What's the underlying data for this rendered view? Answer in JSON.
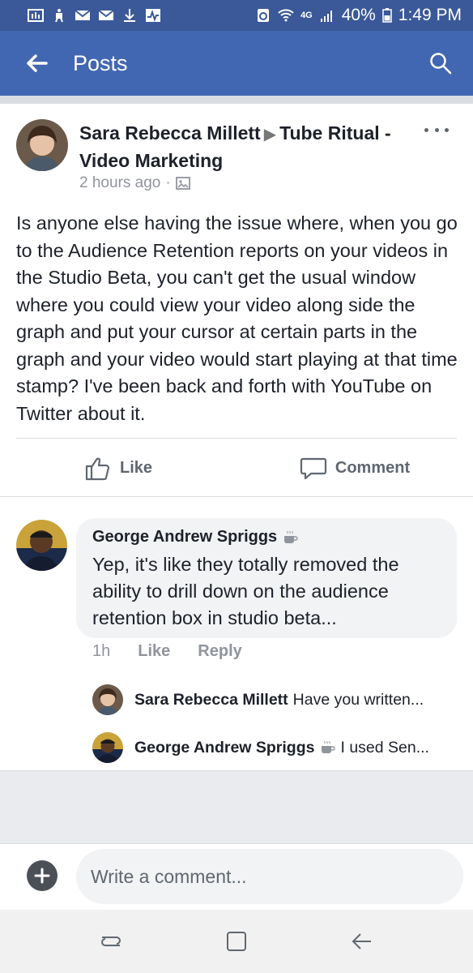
{
  "status_bar": {
    "battery": "40%",
    "time": "1:49 PM",
    "network": "4G"
  },
  "app_bar": {
    "title": "Posts"
  },
  "post": {
    "author": "Sara Rebecca Millett",
    "group": "Tube Ritual - Video Marketing",
    "timestamp": "2 hours ago",
    "body": "Is anyone else having the issue where, when you go to the Audience Retention reports on your videos in the Studio Beta, you can't get the usual window where you could view your video along side the graph and put your cursor at certain parts in the graph and your video would start playing at that time stamp? I've been back and forth with YouTube on Twitter about it.",
    "like_label": "Like",
    "comment_label": "Comment"
  },
  "comment": {
    "author": "George Andrew Spriggs",
    "text": "Yep, it's like they totally removed the ability to drill down on the audience retention box in studio beta...",
    "time": "1h",
    "like_label": "Like",
    "reply_label": "Reply"
  },
  "replies": [
    {
      "author": "Sara Rebecca Millett",
      "preview": "Have you written..."
    },
    {
      "author": "George Andrew Spriggs",
      "preview": "I used Sen..."
    }
  ],
  "composer": {
    "placeholder": "Write a comment..."
  },
  "colors": {
    "app_bar": "#4267b2",
    "status_bar": "#3b5998",
    "action_text": "#606770",
    "meta_text": "#90949c"
  },
  "icons": [
    "back-arrow-icon",
    "search-icon",
    "more-icon",
    "photo-icon",
    "like-icon",
    "comment-icon",
    "coffee-icon",
    "plus-icon",
    "recent-apps-icon",
    "home-icon",
    "nav-back-icon"
  ]
}
